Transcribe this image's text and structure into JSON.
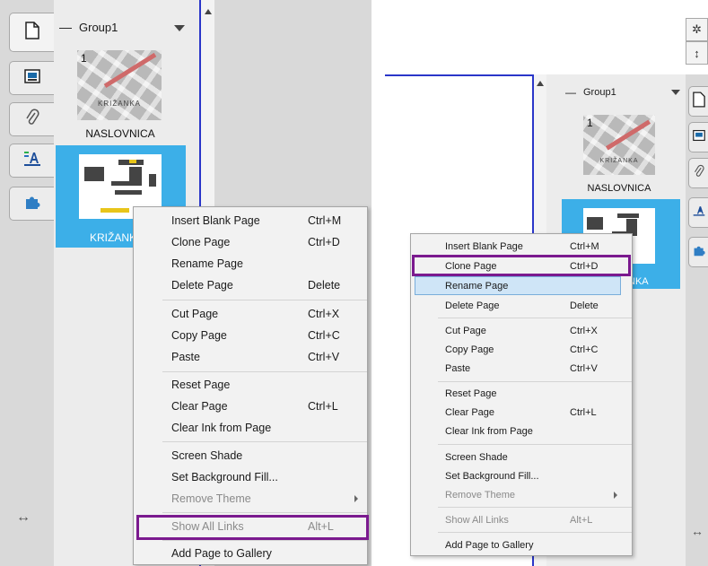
{
  "group": {
    "name": "Group1"
  },
  "pages": [
    {
      "number": "1",
      "caption": "KRIŽANKA",
      "label": "NASLOVNICA"
    },
    {
      "label": "KRIŽANKA"
    }
  ],
  "left_tabs": [
    "page-icon",
    "image-icon",
    "paperclip-icon",
    "properties-icon",
    "addons-icon"
  ],
  "left_bottom_icon": "↔",
  "right_tools": [
    "gear-icon",
    "resize-icon"
  ],
  "right_bottom_icon": "↔",
  "menu": {
    "items": [
      {
        "label": "Insert Blank Page",
        "shortcut": "Ctrl+M"
      },
      {
        "label": "Clone Page",
        "shortcut": "Ctrl+D"
      },
      {
        "label": "Rename Page",
        "shortcut": ""
      },
      {
        "label": "Delete Page",
        "shortcut": "Delete"
      },
      {
        "label": "Cut Page",
        "shortcut": "Ctrl+X"
      },
      {
        "label": "Copy Page",
        "shortcut": "Ctrl+C"
      },
      {
        "label": "Paste",
        "shortcut": "Ctrl+V"
      },
      {
        "label": "Reset Page",
        "shortcut": ""
      },
      {
        "label": "Clear Page",
        "shortcut": "Ctrl+L"
      },
      {
        "label": "Clear Ink from Page",
        "shortcut": ""
      },
      {
        "label": "Screen Shade",
        "shortcut": ""
      },
      {
        "label": "Set Background Fill...",
        "shortcut": ""
      },
      {
        "label": "Remove Theme",
        "shortcut": "",
        "disabled": true,
        "submenu": true
      },
      {
        "label": "Show All Links",
        "shortcut": "Alt+L",
        "disabled": true
      },
      {
        "label": "Add Page to Gallery",
        "shortcut": ""
      }
    ]
  },
  "right_menu_hover_item": "Rename Page",
  "highlight_color": "#7b1a8f",
  "selection_color": "#3cafe8",
  "border_color": "#2a36c9"
}
